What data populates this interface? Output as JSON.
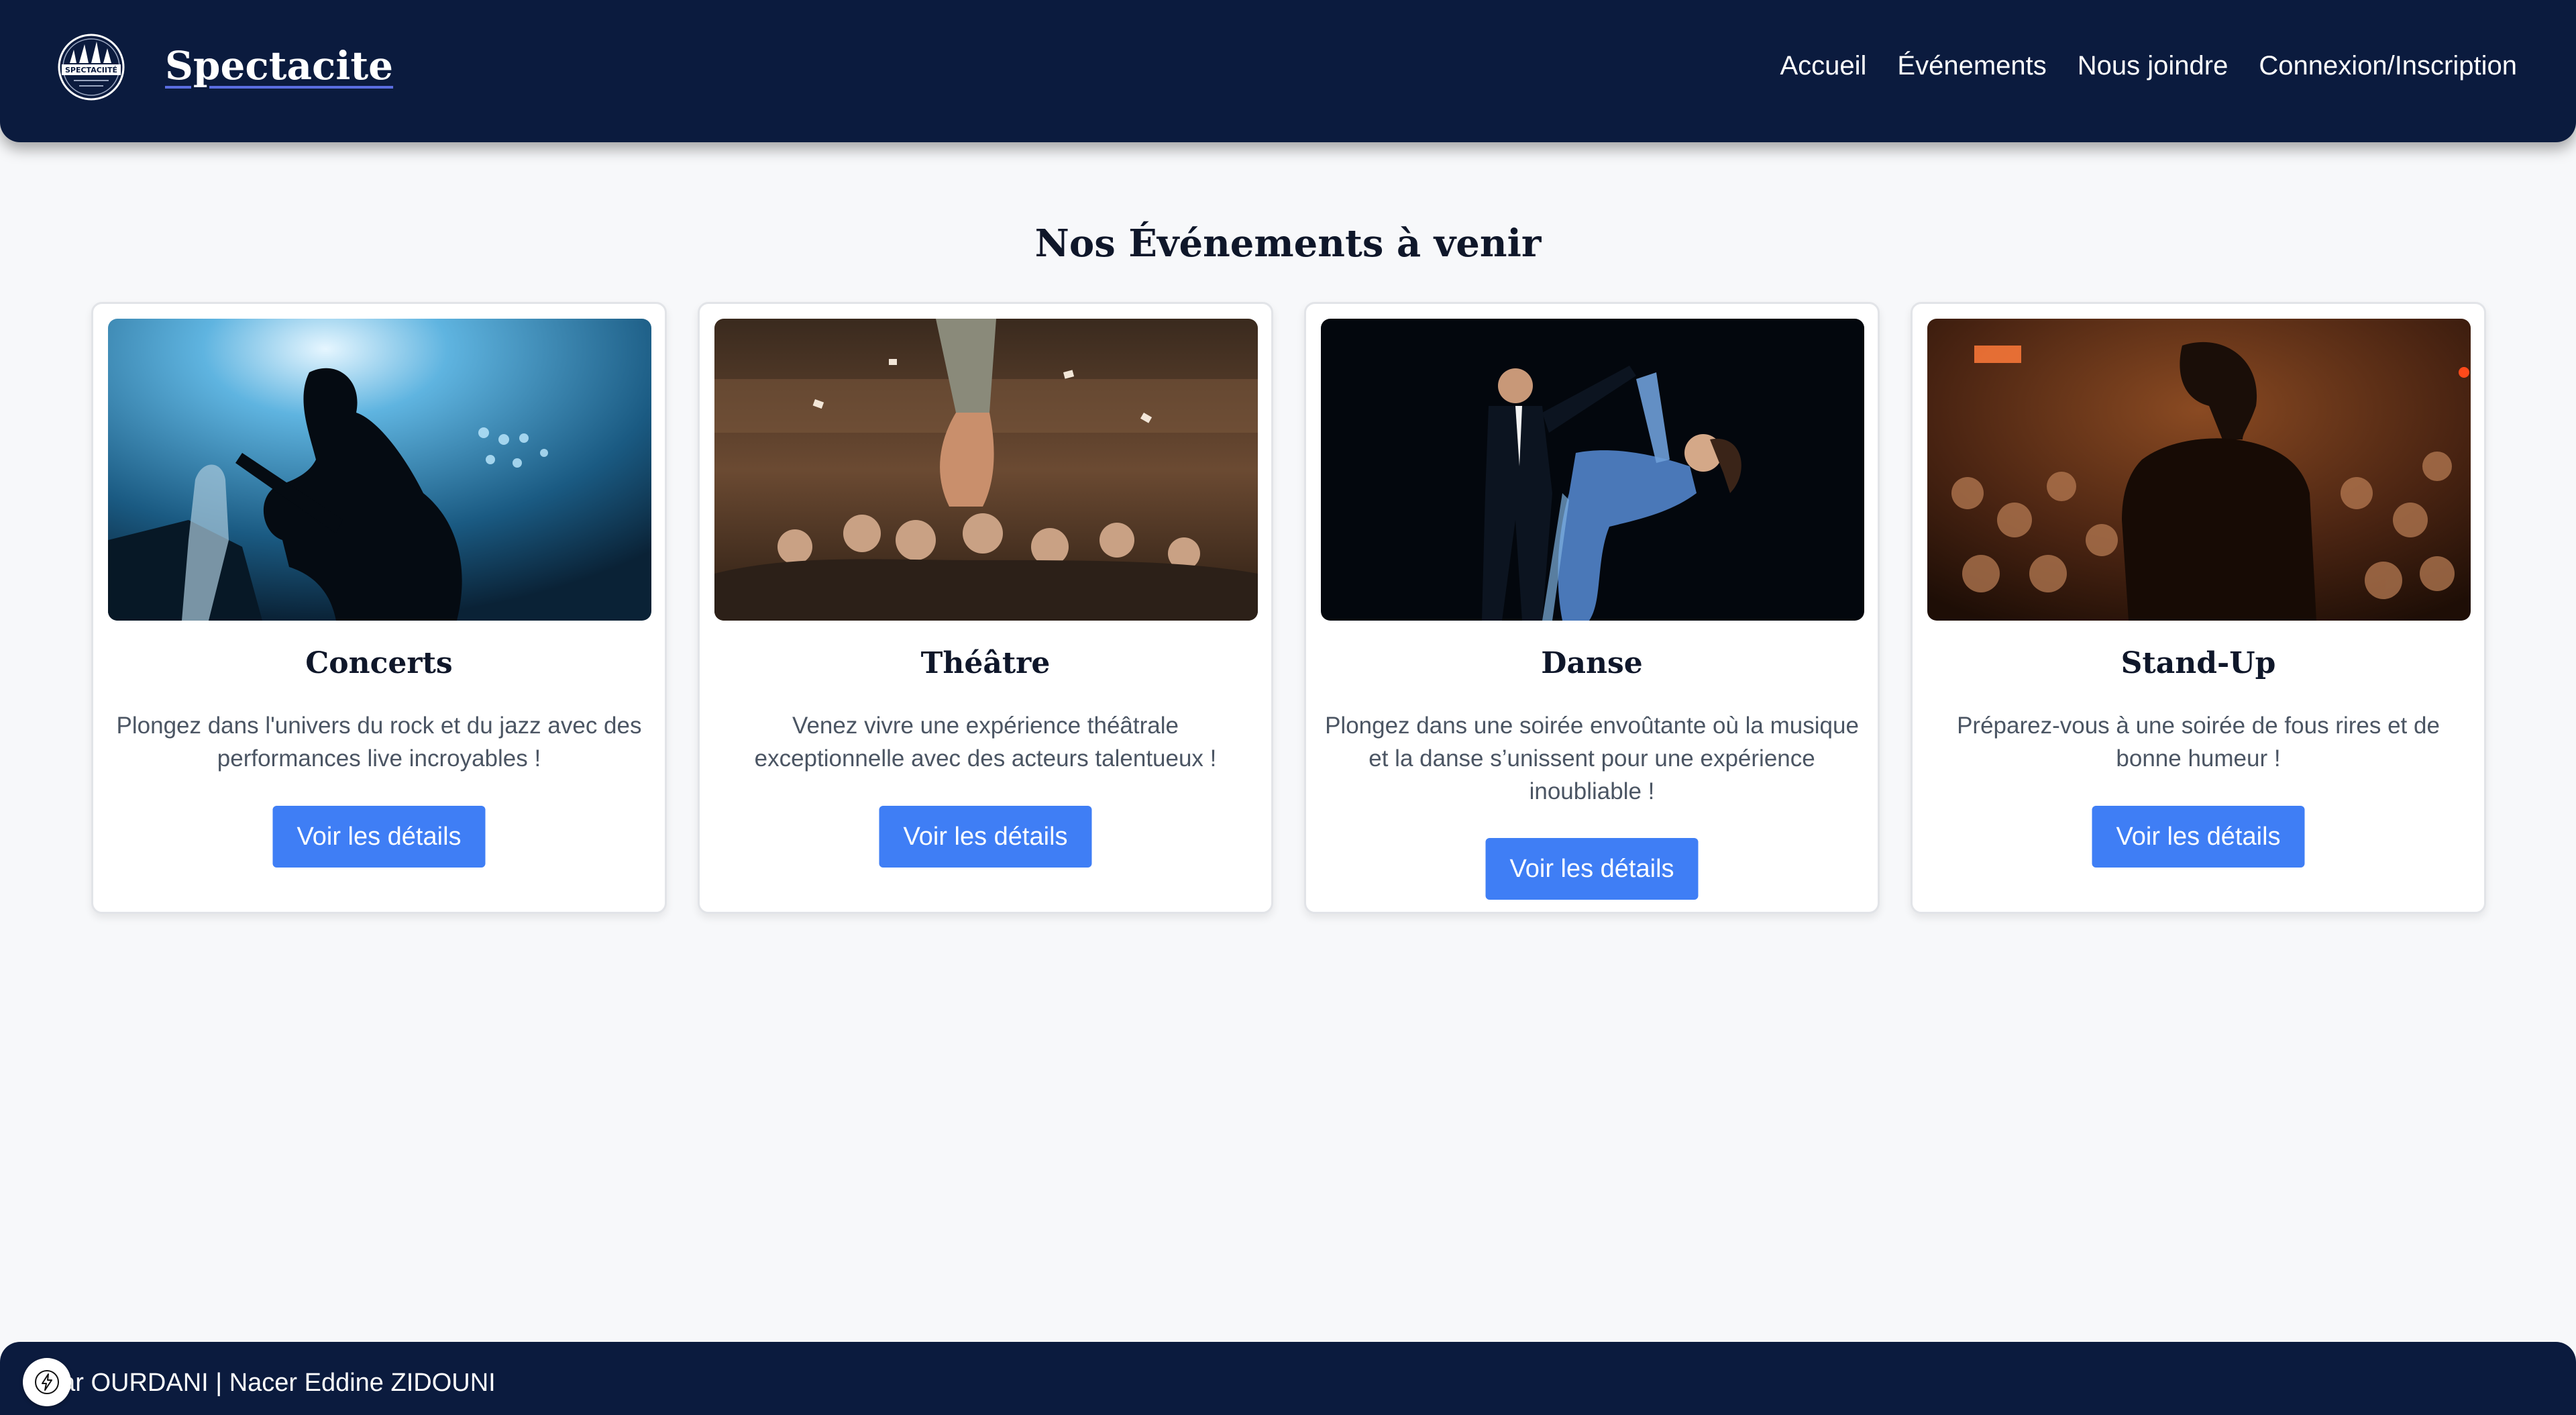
{
  "header": {
    "brand": "Spectacite",
    "logo_icon": "spectacite-logo",
    "logo_text": "SPECTACIITÉ",
    "nav": [
      {
        "label": "Accueil"
      },
      {
        "label": "Événements"
      },
      {
        "label": "Nous joindre"
      },
      {
        "label": "Connexion/Inscription"
      }
    ]
  },
  "main": {
    "title": "Nos Événements à venir",
    "cards": [
      {
        "image_icon": "concert-photo",
        "title": "Concerts",
        "description": "Plongez dans l'univers du rock et du jazz avec des performances live incroyables !",
        "button": "Voir les détails"
      },
      {
        "image_icon": "theatre-photo",
        "title": "Théâtre",
        "description": "Venez vivre une expérience théâtrale exceptionnelle avec des acteurs talentueux !",
        "button": "Voir les détails"
      },
      {
        "image_icon": "dance-photo",
        "title": "Danse",
        "description": "Plongez dans une soirée envoûtante où la musique et la danse s’unissent pour une expérience inoubliable !",
        "button": "Voir les détails"
      },
      {
        "image_icon": "standup-photo",
        "title": "Stand-Up",
        "description": "Préparez-vous à une soirée de fous rires et de bonne humeur !",
        "button": "Voir les détails"
      }
    ]
  },
  "footer": {
    "text": "har OURDANI | Nacer Eddine ZIDOUNI",
    "badge_icon": "lightning-icon"
  },
  "colors": {
    "header_bg": "#0b1b3e",
    "page_bg": "#f7f8fa",
    "button_bg": "#3f7ef5"
  }
}
